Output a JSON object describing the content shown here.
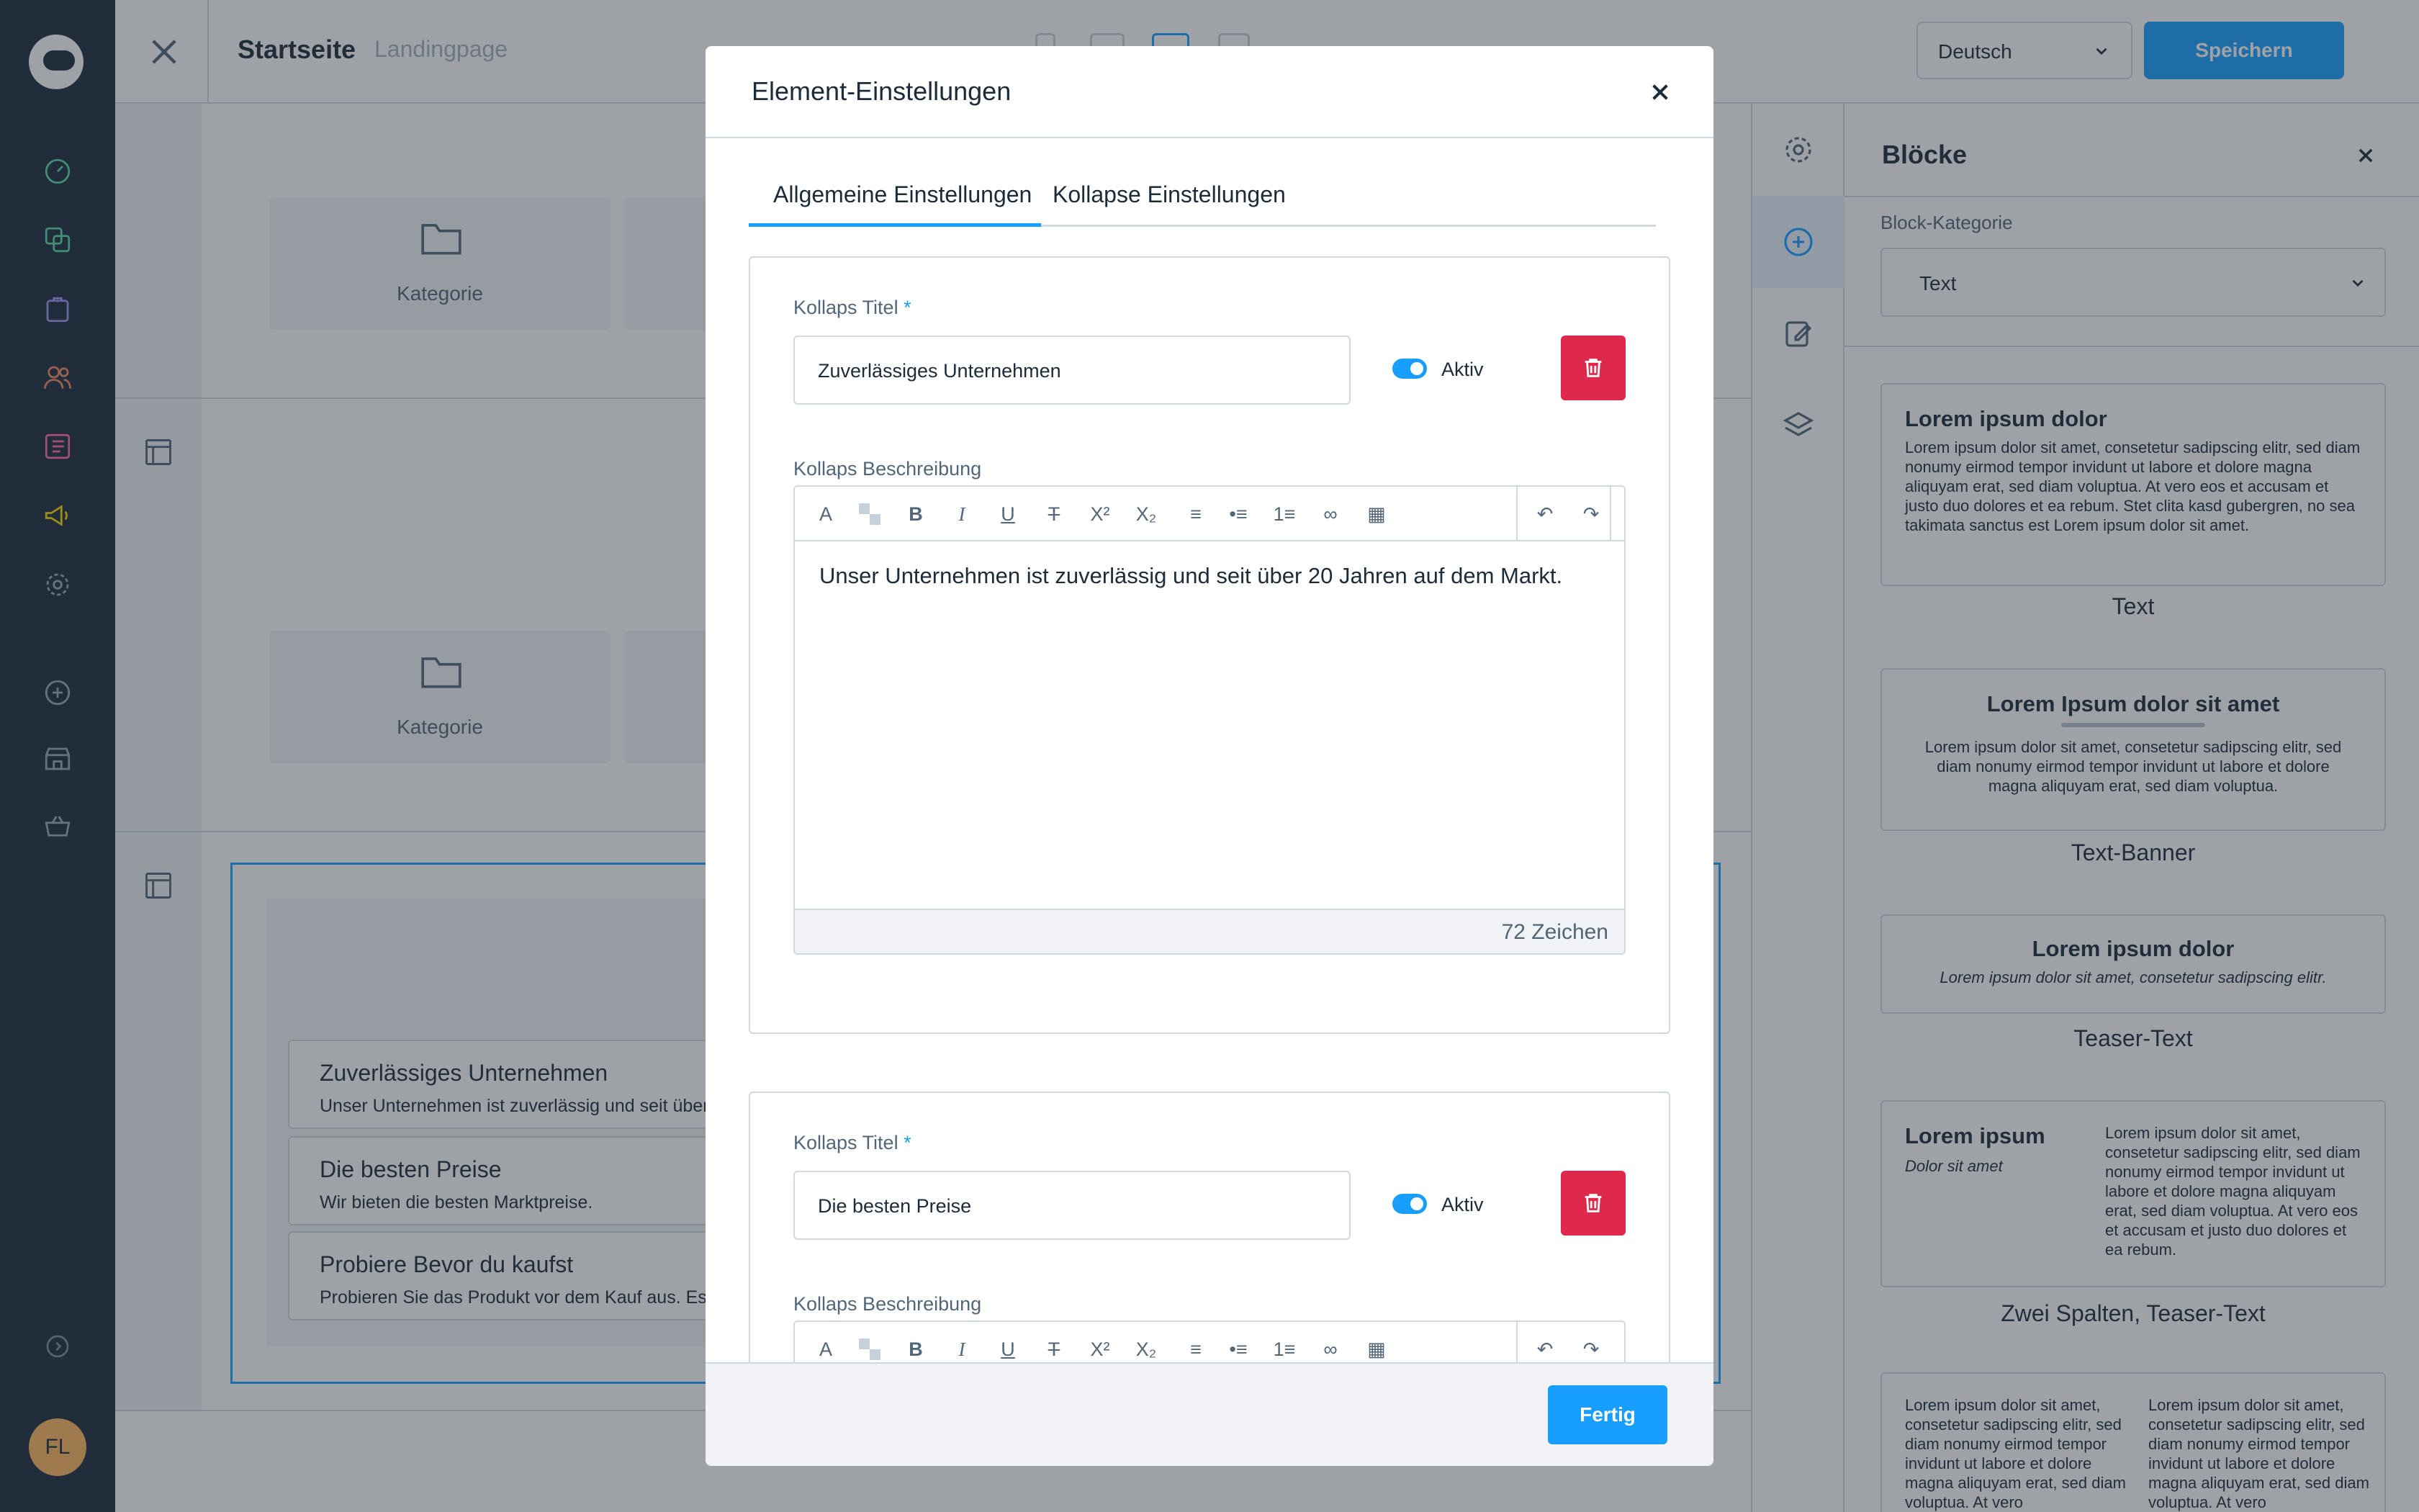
{
  "topbar": {
    "title": "Startseite",
    "subtitle": "Landingpage",
    "language": "Deutsch",
    "save_label": "Speichern"
  },
  "leftnav": {
    "avatar_initials": "FL"
  },
  "canvas": {
    "category_label_1": "Kategorie",
    "category_label_2": "Kategorie",
    "accordion": [
      {
        "title": "Zuverlässiges Unternehmen",
        "desc": "Unser Unternehmen ist zuverlässig und seit über"
      },
      {
        "title": "Die besten Preise",
        "desc": "Wir bieten die besten Marktpreise."
      },
      {
        "title": "Probiere Bevor du kaufst",
        "desc": "Probieren Sie das Produkt vor dem Kauf aus. Es g"
      }
    ]
  },
  "blocks": {
    "title": "Blöcke",
    "category_label": "Block-Kategorie",
    "category_value": "Text",
    "previews": [
      {
        "heading": "Lorem ipsum dolor",
        "body": "Lorem ipsum dolor sit amet, consetetur sadipscing elitr, sed diam nonumy eirmod tempor invidunt ut labore et dolore magna aliquyam erat, sed diam voluptua. At vero eos et accusam et justo duo dolores et ea rebum. Stet clita kasd gubergren, no sea takimata sanctus est Lorem ipsum dolor sit amet.",
        "label": "Text"
      },
      {
        "heading": "Lorem Ipsum dolor sit amet",
        "body": "Lorem ipsum dolor sit amet, consetetur sadipscing elitr, sed diam nonumy eirmod tempor invidunt ut labore et dolore magna aliquyam erat, sed diam voluptua.",
        "label": "Text-Banner"
      },
      {
        "heading": "Lorem ipsum dolor",
        "body": "Lorem ipsum dolor sit amet, consetetur sadipscing elitr.",
        "label": "Teaser-Text"
      },
      {
        "heading": "Lorem ipsum",
        "subheading": "Dolor sit amet",
        "body": "Lorem ipsum dolor sit amet, consetetur sadipscing elitr, sed diam nonumy eirmod tempor invidunt ut labore et dolore magna aliquyam erat, sed diam voluptua. At vero eos et accusam et justo duo dolores et ea rebum.",
        "label": "Zwei Spalten, Teaser-Text"
      },
      {
        "body_left": "Lorem ipsum dolor sit amet, consetetur sadipscing elitr, sed diam nonumy eirmod tempor invidunt ut labore et dolore magna aliquyam erat, sed diam voluptua. At vero",
        "body_right": "Lorem ipsum dolor sit amet, consetetur sadipscing elitr, sed diam nonumy eirmod tempor invidunt ut labore et dolore magna aliquyam erat, sed diam voluptua. At vero"
      }
    ]
  },
  "modal": {
    "title": "Element-Einstellungen",
    "tabs": [
      "Allgemeine Einstellungen",
      "Kollapse Einstellungen"
    ],
    "active_tab": "Allgemeine Einstellungen",
    "items": [
      {
        "title_label": "Kollaps Titel",
        "required_mark": "*",
        "title_value": "Zuverlässiges Unternehmen",
        "active_label": "Aktiv",
        "active": true,
        "desc_label": "Kollaps Beschreibung",
        "desc_value": "Unser Unternehmen ist zuverlässig und seit über 20 Jahren auf dem Markt.",
        "char_count": "72 Zeichen"
      },
      {
        "title_label": "Kollaps Titel",
        "required_mark": "*",
        "title_value": "Die besten Preise",
        "active_label": "Aktiv",
        "active": true,
        "desc_label": "Kollaps Beschreibung"
      }
    ],
    "done_label": "Fertig"
  },
  "colors": {
    "primary": "#189eff",
    "danger": "#de294c",
    "nav_bg": "#1c2b3a",
    "avatar": "#ffb75d"
  }
}
